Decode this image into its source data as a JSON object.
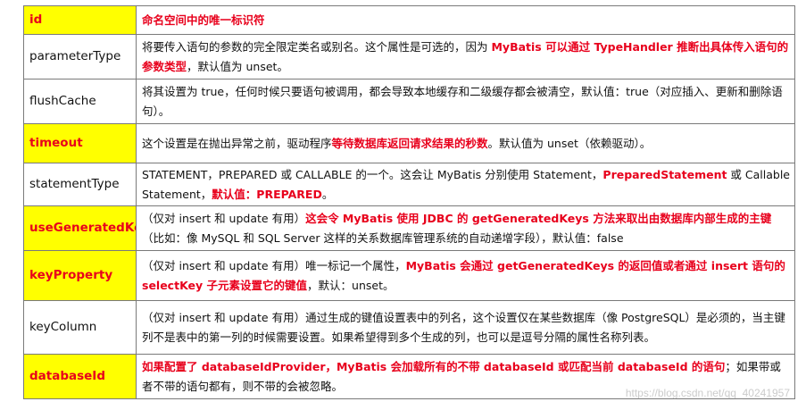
{
  "rows": [
    {
      "key": "id",
      "highlight": true,
      "desc_red_all": true,
      "segments": [
        {
          "t": "命名空间中的唯一标识符",
          "red": true
        }
      ]
    },
    {
      "key": "parameterType",
      "highlight": false,
      "segments": [
        {
          "t": "将要传入语句的参数的完全限定类名或别名。这个属性是可选的，因为 ",
          "red": false
        },
        {
          "t": "MyBatis 可以通过 TypeHandler 推断出具体传入语句的参数类型",
          "red": true
        },
        {
          "t": "，默认值为 unset。",
          "red": false
        }
      ]
    },
    {
      "key": "flushCache",
      "highlight": false,
      "segments": [
        {
          "t": "将其设置为 true，任何时候只要语句被调用，都会导致本地缓存和二级缓存都会被清空，默认值：true（对应插入、更新和删除语句）。",
          "red": false
        }
      ]
    },
    {
      "key": "timeout",
      "highlight": true,
      "segments": [
        {
          "t": "这个设置是在抛出异常之前，驱动程序",
          "red": false
        },
        {
          "t": "等待数据库返回请求结果的秒数",
          "red": true
        },
        {
          "t": "。默认值为 unset（依赖驱动）。",
          "red": false
        }
      ]
    },
    {
      "key": "statementType",
      "highlight": false,
      "segments": [
        {
          "t": "STATEMENT，PREPARED 或 CALLABLE 的一个。这会让 MyBatis 分别使用 Statement，",
          "red": false
        },
        {
          "t": "PreparedStatement",
          "red": true
        },
        {
          "t": " 或 CallableStatement，",
          "red": false
        },
        {
          "t": "默认值：PREPARED",
          "red": true
        },
        {
          "t": "。",
          "red": false
        }
      ]
    },
    {
      "key": "useGeneratedKeys",
      "highlight": true,
      "segments": [
        {
          "t": "（仅对 insert 和 update 有用）",
          "red": false
        },
        {
          "t": "这会令 MyBatis 使用 JDBC 的 getGeneratedKeys 方法来取出由数据库内部生成的主键",
          "red": true
        },
        {
          "t": "（比如：像 MySQL 和 SQL Server 这样的关系数据库管理系统的自动递增字段），默认值：false",
          "red": false
        }
      ]
    },
    {
      "key": "keyProperty",
      "highlight": true,
      "segments": [
        {
          "t": "（仅对 insert 和 update 有用）唯一标记一个属性，",
          "red": false
        },
        {
          "t": "MyBatis 会通过 getGeneratedKeys 的返回值或者通过 insert 语句的 selectKey 子元素设置它的键值",
          "red": true
        },
        {
          "t": "，默认：unset。",
          "red": false
        }
      ]
    },
    {
      "key": "keyColumn",
      "highlight": false,
      "segments": [
        {
          "t": "（仅对 insert 和 update 有用）通过生成的键值设置表中的列名，这个设置仅在某些数据库（像 PostgreSQL）是必须的，当主键列不是表中的第一列的时候需要设置。如果希望得到多个生成的列，也可以是逗号分隔的属性名称列表。",
          "red": false
        }
      ]
    },
    {
      "key": "databaseId",
      "highlight": true,
      "segments": [
        {
          "t": "如果配置了 databaseIdProvider，MyBatis 会加载所有的不带 databaseId 或匹配当前 databaseId 的语句",
          "red": true
        },
        {
          "t": "；如果带或者不带的语句都有，则不带的会被忽略。",
          "red": false
        }
      ]
    }
  ],
  "watermark": "https://blog.csdn.net/qq_40241957"
}
